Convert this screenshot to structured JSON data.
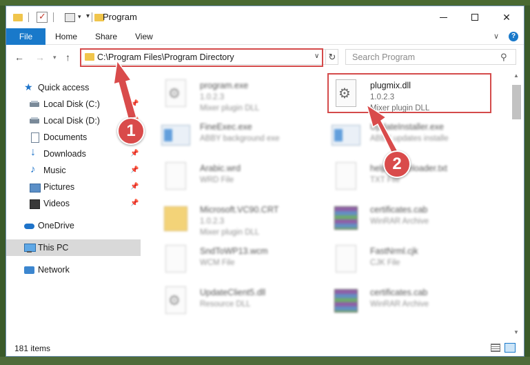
{
  "window": {
    "title": "Program"
  },
  "ribbon": {
    "tabs": [
      {
        "label": "File"
      },
      {
        "label": "Home"
      },
      {
        "label": "Share"
      },
      {
        "label": "View"
      }
    ]
  },
  "address": {
    "path": "C:\\Program Files\\Program Directory"
  },
  "search": {
    "placeholder": "Search Program"
  },
  "sidebar": {
    "items": [
      {
        "label": "Quick access",
        "icon": "star-icon"
      },
      {
        "label": "Local Disk (C:)",
        "icon": "disk-icon",
        "pinned": true
      },
      {
        "label": "Local Disk (D:)",
        "icon": "disk-icon",
        "pinned": true
      },
      {
        "label": "Documents",
        "icon": "documents-icon",
        "pinned": true
      },
      {
        "label": "Downloads",
        "icon": "downloads-icon",
        "pinned": true
      },
      {
        "label": "Music",
        "icon": "music-icon",
        "pinned": true
      },
      {
        "label": "Pictures",
        "icon": "pictures-icon",
        "pinned": true
      },
      {
        "label": "Videos",
        "icon": "videos-icon",
        "pinned": true
      },
      {
        "label": "OneDrive",
        "icon": "onedrive-icon"
      },
      {
        "label": "This PC",
        "icon": "pc-icon",
        "selected": true
      },
      {
        "label": "Network",
        "icon": "network-icon"
      }
    ]
  },
  "files": [
    {
      "name": "program.exe",
      "sub1": "1.0.2.3",
      "sub2": "Mixer plugin DLL",
      "icon": "gear-icon",
      "blurred": true
    },
    {
      "name": "plugmix.dll",
      "sub1": "1.0.2.3",
      "sub2": "Mixer plugin DLL",
      "icon": "gear-icon",
      "blurred": false
    },
    {
      "name": "FineExec.exe",
      "sub1": "ABBY background exe",
      "sub2": "",
      "icon": "exe-icon",
      "blurred": true
    },
    {
      "name": "UpdateInstaller.exe",
      "sub1": "ABBY updates installe",
      "sub2": "",
      "icon": "exe-icon",
      "blurred": true
    },
    {
      "name": "Arabic.wrd",
      "sub1": "WRD File",
      "sub2": "",
      "icon": "document-icon",
      "blurred": true
    },
    {
      "name": "help.imageloader.txt",
      "sub1": "TXT File",
      "sub2": "",
      "icon": "document-icon",
      "blurred": true
    },
    {
      "name": "Microsoft.VC90.CRT",
      "sub1": "1.0.2.3",
      "sub2": "Mixer plugin DLL",
      "icon": "folder-icon",
      "blurred": true
    },
    {
      "name": "certificates.cab",
      "sub1": "WinRAR Archive",
      "sub2": "",
      "icon": "archive-icon",
      "blurred": true
    },
    {
      "name": "SndToWP13.wcm",
      "sub1": "WCM File",
      "sub2": "",
      "icon": "document-icon",
      "blurred": true
    },
    {
      "name": "FastNrml.cjk",
      "sub1": "CJK File",
      "sub2": "",
      "icon": "document-icon",
      "blurred": true
    },
    {
      "name": "UpdateClient5.dll",
      "sub1": "Resource DLL",
      "sub2": "",
      "icon": "gear-icon",
      "blurred": true
    },
    {
      "name": "certificates.cab",
      "sub1": "WinRAR Archive",
      "sub2": "",
      "icon": "archive-icon",
      "blurred": true
    }
  ],
  "status": {
    "item_count": "181 items"
  },
  "annotations": [
    {
      "label": "1"
    },
    {
      "label": "2"
    }
  ],
  "colors": {
    "accent": "#1979ca",
    "highlight": "#d44a4a",
    "badge": "#d94b4b",
    "folder": "#f0c54c",
    "selected": "#d9d9d9"
  }
}
